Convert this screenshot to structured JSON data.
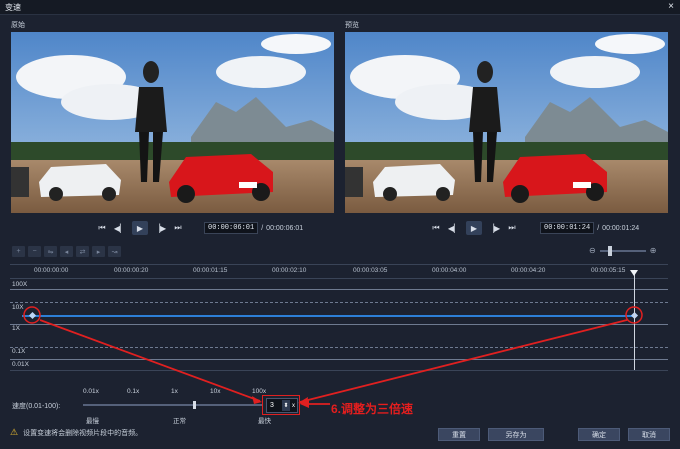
{
  "window": {
    "title": "变速",
    "close": "×"
  },
  "panes": {
    "original_label": "原始",
    "preview_label": "预览"
  },
  "left_controls": {
    "timecode": "00:00:06:01",
    "separator": "/",
    "duration": "00:00:06:01"
  },
  "right_controls": {
    "timecode": "00:00:01:24",
    "separator": "/",
    "duration": "00:00:01:24"
  },
  "ruler": [
    "00:00:00:00",
    "00:00:00:20",
    "00:00:01:15",
    "00:00:02:10",
    "00:00:03:05",
    "00:00:04:00",
    "00:00:04:20",
    "00:00:05:15"
  ],
  "graph_labels": {
    "y100": "100X",
    "y10": "10X",
    "y1": "1X",
    "y01": "0.1X",
    "y001": "0.01X"
  },
  "speed": {
    "label": "速度(0.01-100):",
    "ticks": [
      "0.01x",
      "0.1x",
      "1x",
      "10x",
      "100x"
    ],
    "labels": {
      "slowest": "最慢",
      "normal": "正常",
      "fastest": "最快"
    },
    "value": "3"
  },
  "annotation": "6.调整为三倍速",
  "warning": "设置变速将会删除视频片段中的音频。",
  "buttons": {
    "reset": "重置",
    "save_as": "另存为",
    "ok": "确定",
    "cancel": "取消"
  }
}
